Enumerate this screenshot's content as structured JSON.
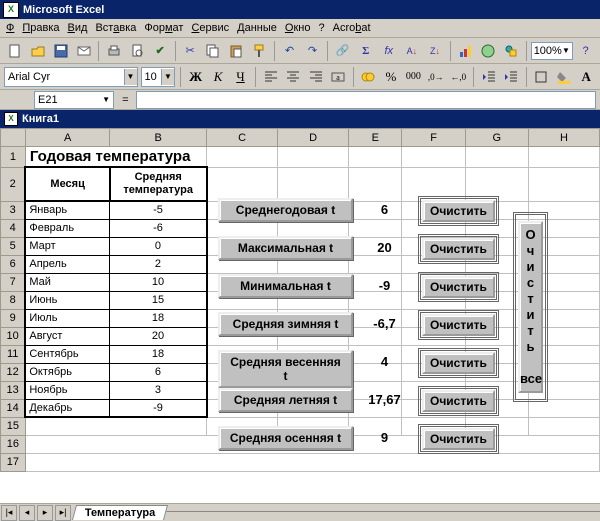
{
  "app": {
    "title": "Microsoft Excel"
  },
  "menu": {
    "file": "Файл",
    "edit": "Правка",
    "view": "Вид",
    "insert": "Вставка",
    "format": "Формат",
    "tools": "Сервис",
    "data": "Данные",
    "window": "Окно",
    "help": "?",
    "acrobat": "Acrobat"
  },
  "fmt": {
    "font": "Arial Cyr",
    "size": "10",
    "bold": "Ж",
    "italic": "К",
    "underline": "Ч"
  },
  "zoom": "100%",
  "namebox": "E21",
  "book": {
    "title": "Книга1"
  },
  "cols": [
    "A",
    "B",
    "C",
    "D",
    "E",
    "F",
    "G",
    "H"
  ],
  "rows": [
    "1",
    "2",
    "3",
    "4",
    "5",
    "6",
    "7",
    "8",
    "9",
    "10",
    "11",
    "12",
    "13",
    "14",
    "15",
    "16",
    "17"
  ],
  "title_cell": "Годовая температура",
  "header": {
    "month": "Месяц",
    "avg": "Средняя температура"
  },
  "months": [
    "Январь",
    "Февраль",
    "Март",
    "Апрель",
    "Май",
    "Июнь",
    "Июль",
    "Август",
    "Сентябрь",
    "Октябрь",
    "Ноябрь",
    "Декабрь"
  ],
  "temps": [
    "-5",
    "-6",
    "0",
    "2",
    "10",
    "15",
    "18",
    "20",
    "18",
    "6",
    "3",
    "-9"
  ],
  "buttons": {
    "annual": "Среднегодовая t",
    "max": "Максимальная  t",
    "min": "Минимальная  t",
    "winter": "Средняя зимняя t",
    "spring": "Средняя весенняя t",
    "summer": "Средняя летняя t",
    "autumn": "Средняя осенняя t",
    "clear": "Очистить",
    "clear_all_chars": [
      "О",
      "ч",
      "и",
      "с",
      "т",
      "и",
      "т",
      "ь"
    ],
    "clear_all_suffix": "все"
  },
  "results": {
    "annual": "6",
    "max": "20",
    "min": "-9",
    "winter": "-6,7",
    "spring": "4",
    "summer": "17,67",
    "autumn": "9"
  },
  "chart_data": {
    "type": "table",
    "categories": [
      "Январь",
      "Февраль",
      "Март",
      "Апрель",
      "Май",
      "Июнь",
      "Июль",
      "Август",
      "Сентябрь",
      "Октябрь",
      "Ноябрь",
      "Декабрь"
    ],
    "values": [
      -5,
      -6,
      0,
      2,
      10,
      15,
      18,
      20,
      18,
      6,
      3,
      -9
    ],
    "title": "Годовая температура",
    "xlabel": "Месяц",
    "ylabel": "Средняя температура"
  },
  "tab": "Температура"
}
